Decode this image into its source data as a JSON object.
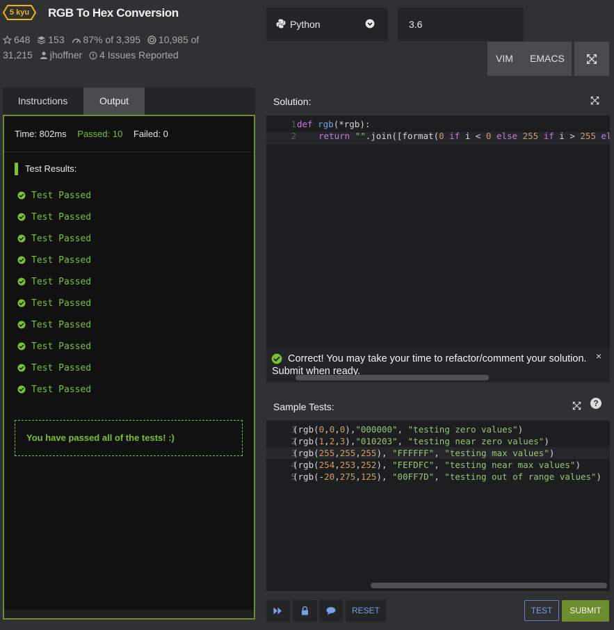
{
  "kata": {
    "rank": "5 kyu",
    "title": "RGB To Hex Conversion",
    "stars": "648",
    "collections": "153",
    "satisfaction": "87% of 3,395",
    "completed": "10,985 of",
    "completed_total": "31,215",
    "author": "jhoffner",
    "issues": "4 Issues Reported"
  },
  "language": {
    "name": "Python",
    "version": "3.6"
  },
  "editor_modes": {
    "vim": "VIM",
    "emacs": "EMACS"
  },
  "left_tabs": {
    "instructions": "Instructions",
    "output": "Output"
  },
  "output": {
    "time": "Time: 802ms",
    "passed": "Passed: 10",
    "failed": "Failed: 0",
    "results_title": "Test Results:",
    "tests": [
      "Test Passed",
      "Test Passed",
      "Test Passed",
      "Test Passed",
      "Test Passed",
      "Test Passed",
      "Test Passed",
      "Test Passed",
      "Test Passed",
      "Test Passed"
    ],
    "summary": "You have passed all of the tests! :)"
  },
  "solution": {
    "title": "Solution:",
    "line_numbers": [
      "1",
      "2"
    ]
  },
  "notice": {
    "message": "Correct! You may take your time to refactor/comment your solution. Submit when ready.",
    "close": "×"
  },
  "sample_tests": {
    "title": "Sample Tests:",
    "help": "?",
    "line_numbers": [
      "1",
      "2",
      "3",
      "4",
      "5"
    ]
  },
  "footer": {
    "reset": "RESET",
    "test": "TEST",
    "submit": "SUBMIT"
  },
  "colors": {
    "accent_green": "#7bc132",
    "submit_green": "#6c8e2e",
    "blue": "#7a9ee8",
    "rank_gold": "#ecb613",
    "background": "#303133"
  }
}
